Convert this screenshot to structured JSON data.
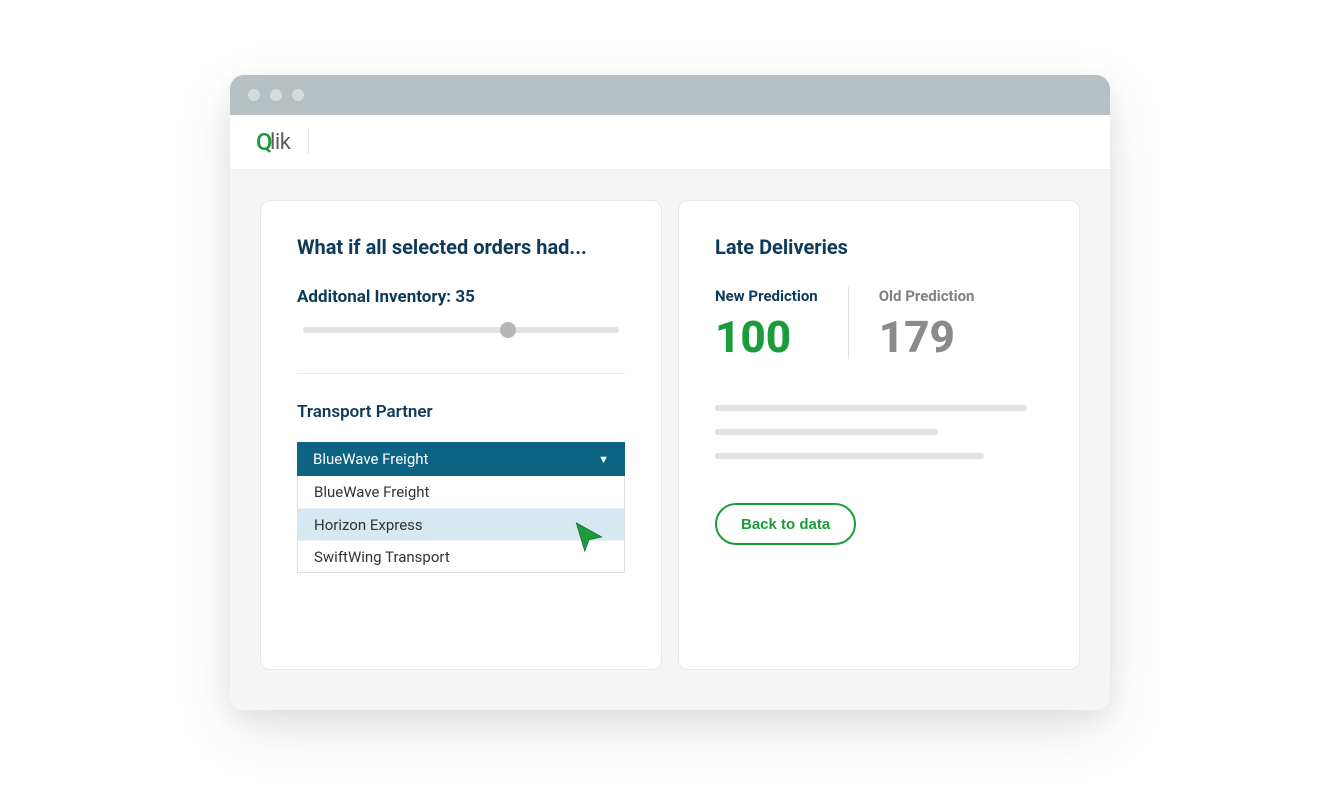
{
  "header": {
    "logo_text": "lik"
  },
  "whatif_card": {
    "title": "What if all selected orders had...",
    "inventory_label": "Additonal Inventory: 35",
    "slider_value": 35,
    "transport_label": "Transport Partner",
    "selected_option": "BlueWave Freight",
    "options": [
      "BlueWave Freight",
      "Horizon Express",
      "SwiftWing Transport"
    ]
  },
  "deliveries_card": {
    "title": "Late Deliveries",
    "new_pred_label": "New Prediction",
    "new_pred_value": "100",
    "old_pred_label": "Old Prediction",
    "old_pred_value": "179",
    "back_button": "Back to data"
  }
}
